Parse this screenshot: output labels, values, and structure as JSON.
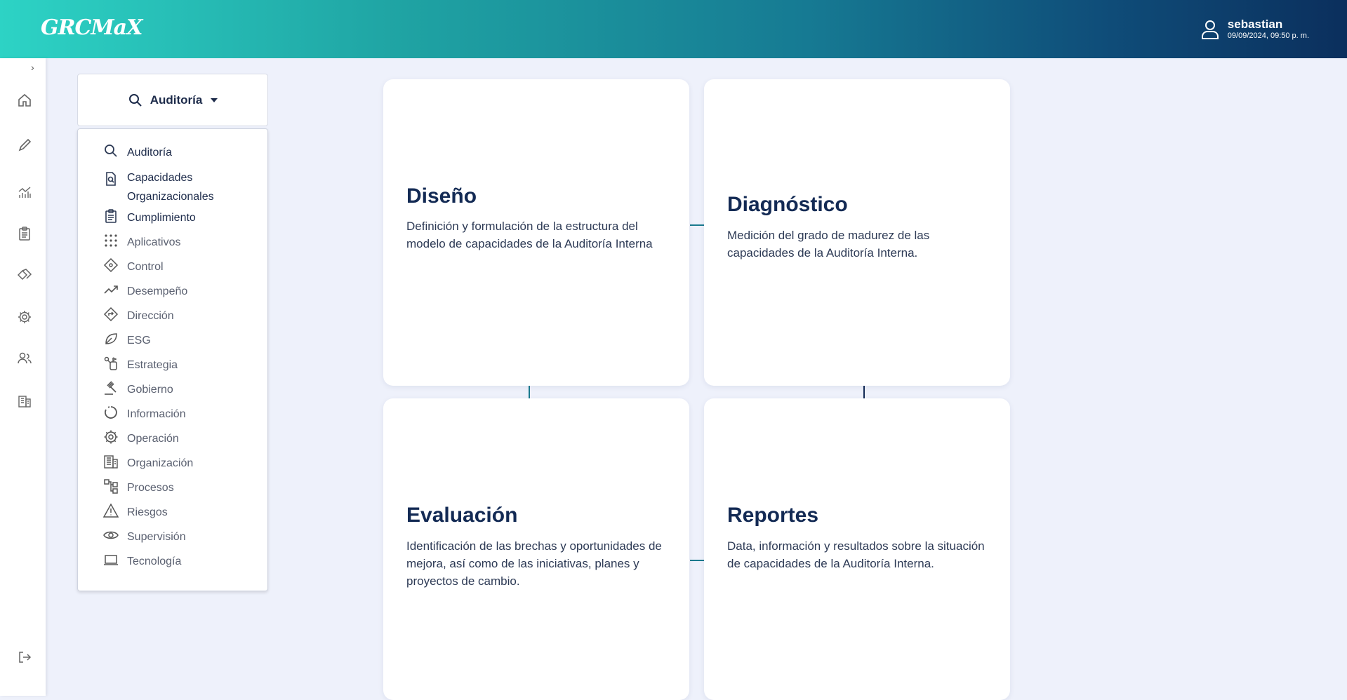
{
  "app": {
    "logo_text": "GRCMaX",
    "user": {
      "name": "sebastian",
      "datetime": "09/09/2024, 09:50 p. m."
    }
  },
  "rail": {
    "toggle": "›",
    "icons": [
      "home-icon",
      "pencil-icon",
      "chart-icon",
      "clipboard-icon",
      "handshake-icon",
      "gear-icon",
      "users-icon",
      "building-icon",
      "logout-icon"
    ]
  },
  "selector": {
    "label": "Auditoría"
  },
  "menu": {
    "items": [
      {
        "label": "Auditoría",
        "icon": "search-icon"
      },
      {
        "label": "Capacidades",
        "label2": "Organizacionales",
        "icon": "doc-search-icon"
      },
      {
        "label": "Cumplimiento",
        "icon": "clipboard-list-icon"
      },
      {
        "label": "Aplicativos",
        "icon": "grid-dots-icon"
      },
      {
        "label": "Control",
        "icon": "control-icon"
      },
      {
        "label": "Desempeño",
        "icon": "trending-icon"
      },
      {
        "label": "Dirección",
        "icon": "direction-icon"
      },
      {
        "label": "ESG",
        "icon": "leaf-icon"
      },
      {
        "label": "Estrategia",
        "icon": "strategy-icon"
      },
      {
        "label": "Gobierno",
        "icon": "gavel-icon"
      },
      {
        "label": "Información",
        "icon": "donut-icon"
      },
      {
        "label": "Operación",
        "icon": "gear-icon"
      },
      {
        "label": "Organización",
        "icon": "building-icon"
      },
      {
        "label": "Procesos",
        "icon": "process-icon"
      },
      {
        "label": "Riesgos",
        "icon": "warning-icon"
      },
      {
        "label": "Supervisión",
        "icon": "eye-icon"
      },
      {
        "label": "Tecnología",
        "icon": "laptop-icon"
      }
    ]
  },
  "cards": [
    {
      "title": "Diseño",
      "desc": "Definición y formulación de la estructura del modelo de capacidades de la Auditoría Interna"
    },
    {
      "title": "Diagnóstico",
      "desc": "Medición del grado de madurez de las capacidades de la Auditoría Interna."
    },
    {
      "title": "Evaluación",
      "desc": "Identificación de las brechas y oportunidades de mejora, así como de las iniciativas, planes y proyectos de cambio."
    },
    {
      "title": "Reportes",
      "desc": "Data, información y resultados sobre la situación de capacidades de la Auditoría Interna."
    }
  ]
}
